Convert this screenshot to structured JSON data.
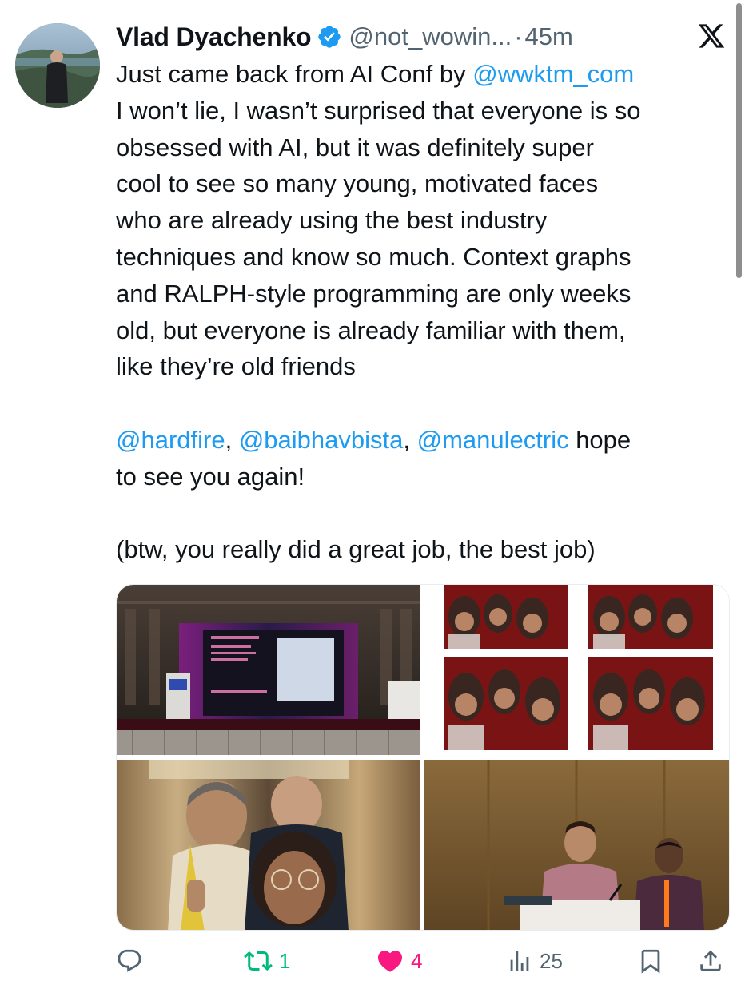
{
  "author": {
    "name": "Vlad Dyachenko",
    "handle": "@not_wowin...",
    "separator": "·",
    "time": "45m",
    "verified_color": "#1d9bf0"
  },
  "platform_icon": "x-logo-icon",
  "tweet": {
    "lines": [
      {
        "parts": [
          {
            "text": "Just came back from AI Conf by ",
            "mention": false
          },
          {
            "text": "@wwktm_com",
            "mention": true
          }
        ]
      },
      {
        "parts": [
          {
            "text": "I won’t lie, I wasn’t surprised that everyone is so",
            "mention": false
          }
        ]
      },
      {
        "parts": [
          {
            "text": "obsessed with AI, but it was definitely super",
            "mention": false
          }
        ]
      },
      {
        "parts": [
          {
            "text": "cool to see so many young, motivated faces",
            "mention": false
          }
        ]
      },
      {
        "parts": [
          {
            "text": "who are already using the best industry",
            "mention": false
          }
        ]
      },
      {
        "parts": [
          {
            "text": "techniques and know so much. Context graphs",
            "mention": false
          }
        ]
      },
      {
        "parts": [
          {
            "text": "and RALPH-style programming are only weeks",
            "mention": false
          }
        ]
      },
      {
        "parts": [
          {
            "text": "old, but everyone is already familiar with them,",
            "mention": false
          }
        ]
      },
      {
        "parts": [
          {
            "text": "like they’re old friends",
            "mention": false
          }
        ]
      },
      {
        "blank": true
      },
      {
        "parts": [
          {
            "text": "@hardfire",
            "mention": true
          },
          {
            "text": ", ",
            "mention": false
          },
          {
            "text": "@baibhavbista",
            "mention": true
          },
          {
            "text": ", ",
            "mention": false
          },
          {
            "text": "@manulectric",
            "mention": true
          },
          {
            "text": " hope",
            "mention": false
          }
        ]
      },
      {
        "parts": [
          {
            "text": "to see you again!",
            "mention": false
          }
        ]
      },
      {
        "blank": true
      },
      {
        "parts": [
          {
            "text": "(btw, you really did a great job, the best job)",
            "mention": false
          }
        ]
      }
    ]
  },
  "media": [
    {
      "name": "conference-stage-photo",
      "kind": "photo"
    },
    {
      "name": "photobooth-strip-photo",
      "kind": "photo"
    },
    {
      "name": "elevator-selfie-photo",
      "kind": "photo"
    },
    {
      "name": "panel-speakers-photo",
      "kind": "photo"
    }
  ],
  "actions": {
    "reply": {
      "icon": "reply-icon",
      "count": ""
    },
    "retweet": {
      "icon": "retweet-icon",
      "count": "1",
      "color": "#00ba7c"
    },
    "like": {
      "icon": "heart-icon",
      "count": "4",
      "color": "#f91880"
    },
    "views": {
      "icon": "views-icon",
      "count": "25"
    },
    "bookmark": {
      "icon": "bookmark-icon"
    },
    "share": {
      "icon": "share-icon"
    }
  },
  "colors": {
    "text": "#0f1419",
    "muted": "#536471",
    "link": "#1d9bf0"
  }
}
